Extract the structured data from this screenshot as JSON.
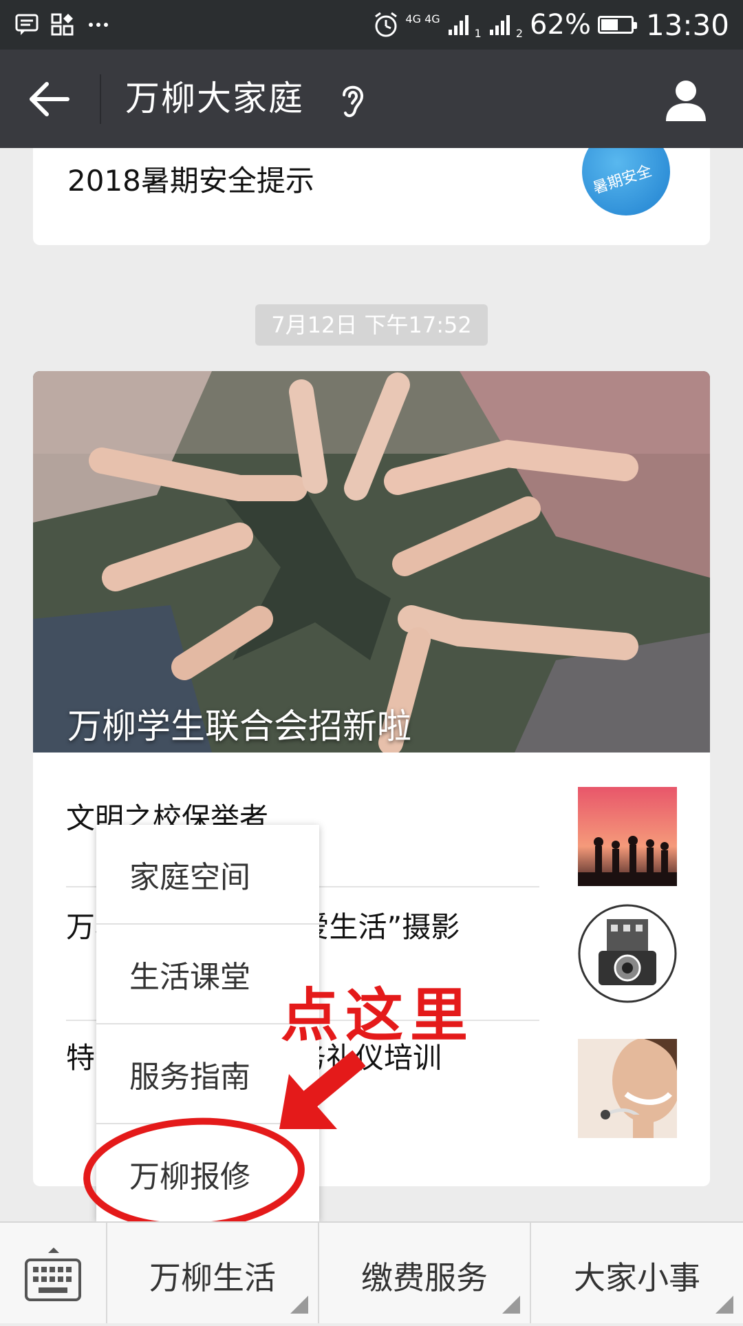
{
  "status_bar": {
    "network": "4G 4G",
    "sim1": "1",
    "sim2": "2",
    "battery_percent": "62%",
    "battery_level": 0.62,
    "time": "13:30"
  },
  "title_bar": {
    "title": "万柳大家庭"
  },
  "chat": {
    "top_card_title": "2018暑期安全提示",
    "top_card_thumb_text": "暑期安全",
    "timestamp": "7月12日 下午17:52",
    "hero_title": "万柳学生联合会招新啦",
    "items": [
      {
        "text": "文明之校保举者"
      },
      {
        "text": "万柳社区“爱摄影•爱生活”摄影"
      },
      {
        "text": "特色服务：开展服务礼仪培训"
      }
    ]
  },
  "popup_menu": {
    "items": [
      {
        "label": "家庭空间"
      },
      {
        "label": "生活课堂"
      },
      {
        "label": "服务指南"
      },
      {
        "label": "万柳报修"
      }
    ]
  },
  "annotation": {
    "text": "点这里",
    "color": "#e41a1a"
  },
  "bottom_bar": {
    "tabs": [
      {
        "label": "万柳生活"
      },
      {
        "label": "缴费服务"
      },
      {
        "label": "大家小事"
      }
    ]
  },
  "colors": {
    "titlebar_bg": "#393a3f",
    "statusbar_bg": "#2b2e30",
    "chat_bg": "#ececec"
  }
}
